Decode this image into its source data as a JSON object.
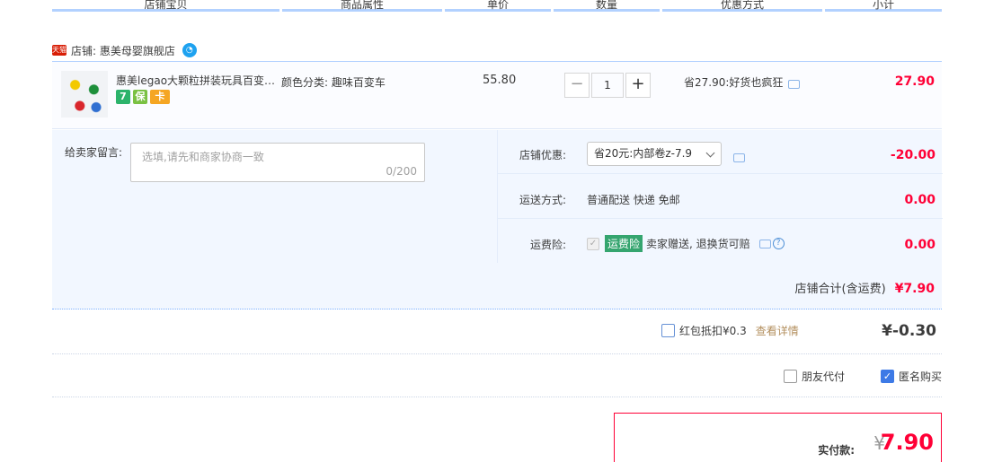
{
  "header": {
    "columns": [
      "店铺宝贝",
      "商品属性",
      "单价",
      "数量",
      "优惠方式",
      "小计"
    ]
  },
  "shop": {
    "badge": "天猫",
    "label": "店铺: 惠美母婴旗舰店",
    "chat_icon": "wangwang-icon"
  },
  "item": {
    "title": "惠美legao大颗粒拼装玩具百变…",
    "badges": [
      "7",
      "保",
      "卡"
    ],
    "attribute": "颜色分类: 趣味百变车",
    "unit_price": "55.80",
    "quantity": "1",
    "minus": "−",
    "plus": "+",
    "promo": "省27.90:好货也疯狂",
    "subtotal": "27.90"
  },
  "memo": {
    "label": "给卖家留言:",
    "placeholder": "选填,请先和商家协商一致",
    "counter": "0/200"
  },
  "shop_coupon": {
    "label": "店铺优惠:",
    "selected": "省20元:内部卷z-7.9",
    "amount": "-20.00"
  },
  "shipping": {
    "label": "运送方式:",
    "value": "普通配送 快递 免邮",
    "amount": "0.00"
  },
  "insurance": {
    "label": "运费险:",
    "tag": "运费险",
    "text": "卖家赠送, 退换货可赔",
    "help": "?",
    "amount": "0.00"
  },
  "shop_total": {
    "label": "店铺合计(含运费)",
    "value": "¥7.90"
  },
  "red_packet": {
    "label": "红包抵扣¥0.3",
    "link": "查看详情",
    "amount": "¥-0.30"
  },
  "options": {
    "friend_pay": "朋友代付",
    "anonymous": "匿名购买",
    "anonymous_checked": true,
    "check_mark": "✓"
  },
  "payment": {
    "label": "实付款:",
    "currency": "¥",
    "value": "7.90"
  },
  "colors": {
    "accent": "#ff0036",
    "header_border": "#b2d1ff",
    "panel_bg": "#f2f7ff"
  }
}
